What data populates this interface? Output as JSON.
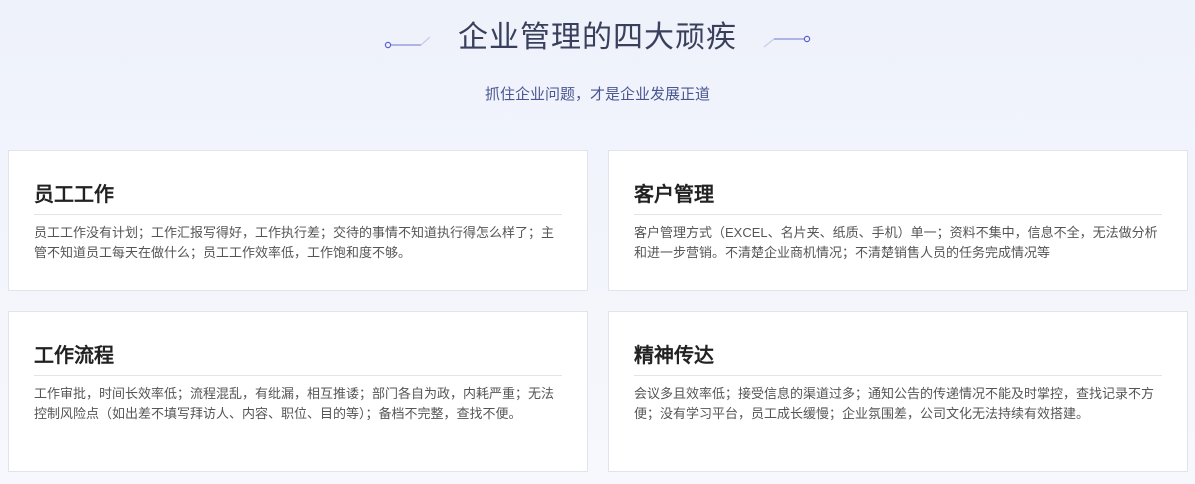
{
  "header": {
    "title": "企业管理的四大顽疾",
    "subtitle": "抓住企业问题，才是企业发展正道"
  },
  "colors": {
    "accent": "#5b5fc7",
    "title": "#3a3f5c",
    "subtitle": "#4a5690"
  },
  "cards": [
    {
      "title": "员工工作",
      "description": "员工工作没有计划；工作汇报写得好，工作执行差；交待的事情不知道执行得怎么样了；主管不知道员工每天在做什么；员工工作效率低，工作饱和度不够。"
    },
    {
      "title": "客户管理",
      "description": "客户管理方式（EXCEL、名片夹、纸质、手机）单一；资料不集中，信息不全，无法做分析和进一步营销。不清楚企业商机情况；不清楚销售人员的任务完成情况等"
    },
    {
      "title": "工作流程",
      "description": "工作审批，时间长效率低；流程混乱，有纰漏，相互推诿；部门各自为政，内耗严重；无法控制风险点（如出差不填写拜访人、内容、职位、目的等）；备档不完整，查找不便。"
    },
    {
      "title": "精神传达",
      "description": "会议多且效率低；接受信息的渠道过多；通知公告的传递情况不能及时掌控，查找记录不方便；没有学习平台，员工成长缓慢；企业氛围差，公司文化无法持续有效搭建。"
    }
  ]
}
